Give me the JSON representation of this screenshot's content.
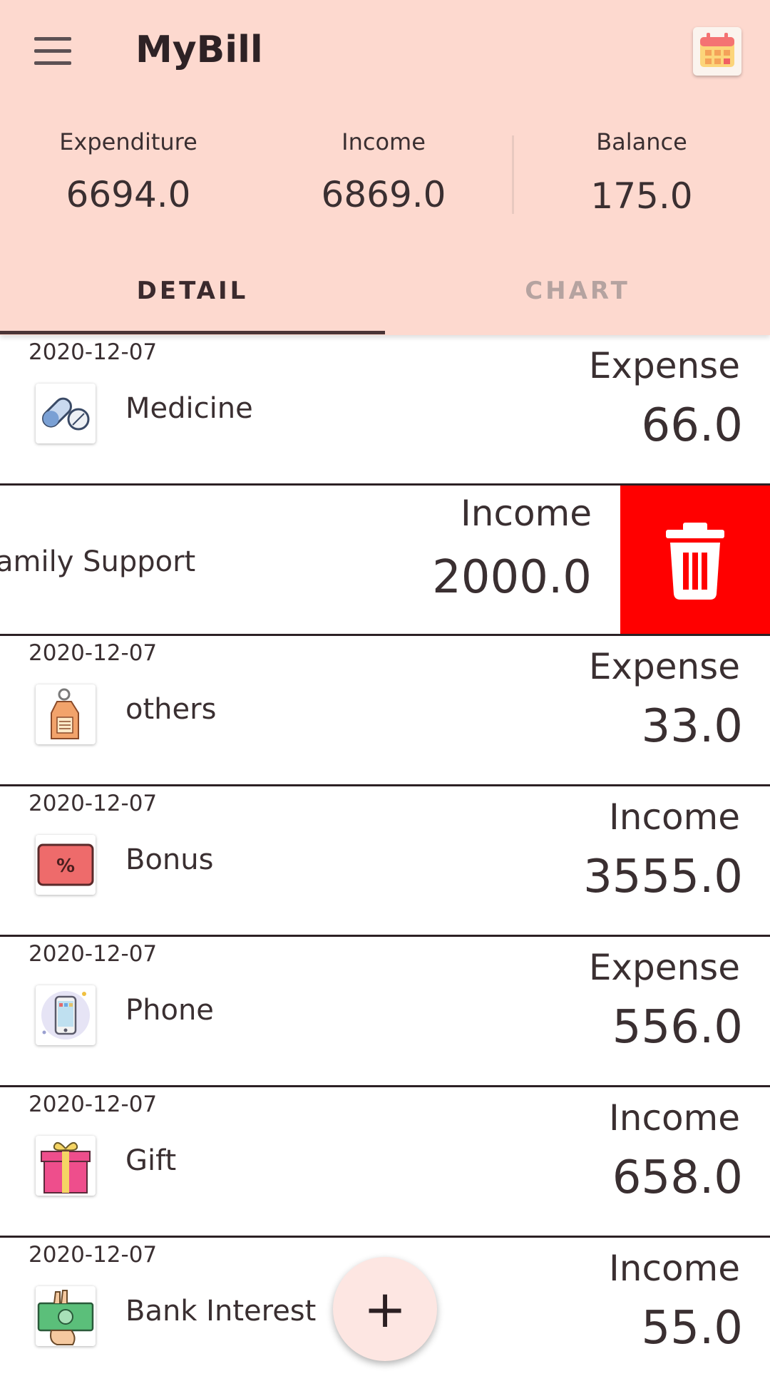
{
  "app": {
    "title": "MyBill"
  },
  "icons": {
    "menu": "hamburger-menu-icon",
    "calendar": "calendar-icon",
    "delete": "trash-icon",
    "add": "plus-icon"
  },
  "summary": {
    "expenditure_label": "Expenditure",
    "expenditure_value": "6694.0",
    "income_label": "Income",
    "income_value": "6869.0",
    "balance_label": "Balance",
    "balance_value": "175.0"
  },
  "tabs": [
    {
      "label": "DETAIL",
      "active": true
    },
    {
      "label": "CHART",
      "active": false
    }
  ],
  "records": [
    {
      "date": "2020-12-07",
      "name": "Medicine",
      "type": "Expense",
      "amount": "66.0",
      "icon": "pill-icon"
    },
    {
      "date": "",
      "name": "amily Support",
      "type": "Income",
      "amount": "2000.0",
      "icon": "",
      "swiped": true
    },
    {
      "date": "2020-12-07",
      "name": "others",
      "type": "Expense",
      "amount": "33.0",
      "icon": "tag-icon"
    },
    {
      "date": "2020-12-07",
      "name": "Bonus",
      "type": "Income",
      "amount": "3555.0",
      "icon": "percent-icon"
    },
    {
      "date": "2020-12-07",
      "name": "Phone",
      "type": "Expense",
      "amount": "556.0",
      "icon": "phone-icon"
    },
    {
      "date": "2020-12-07",
      "name": "Gift",
      "type": "Income",
      "amount": "658.0",
      "icon": "gift-icon"
    },
    {
      "date": "2020-12-07",
      "name": "Bank Interest",
      "type": "Income",
      "amount": "55.0",
      "icon": "cash-icon"
    }
  ],
  "fab": {
    "label": "+"
  },
  "colors": {
    "header_bg": "#fdd9cf",
    "delete_bg": "#ff0000",
    "fab_bg": "#fde6e2"
  }
}
